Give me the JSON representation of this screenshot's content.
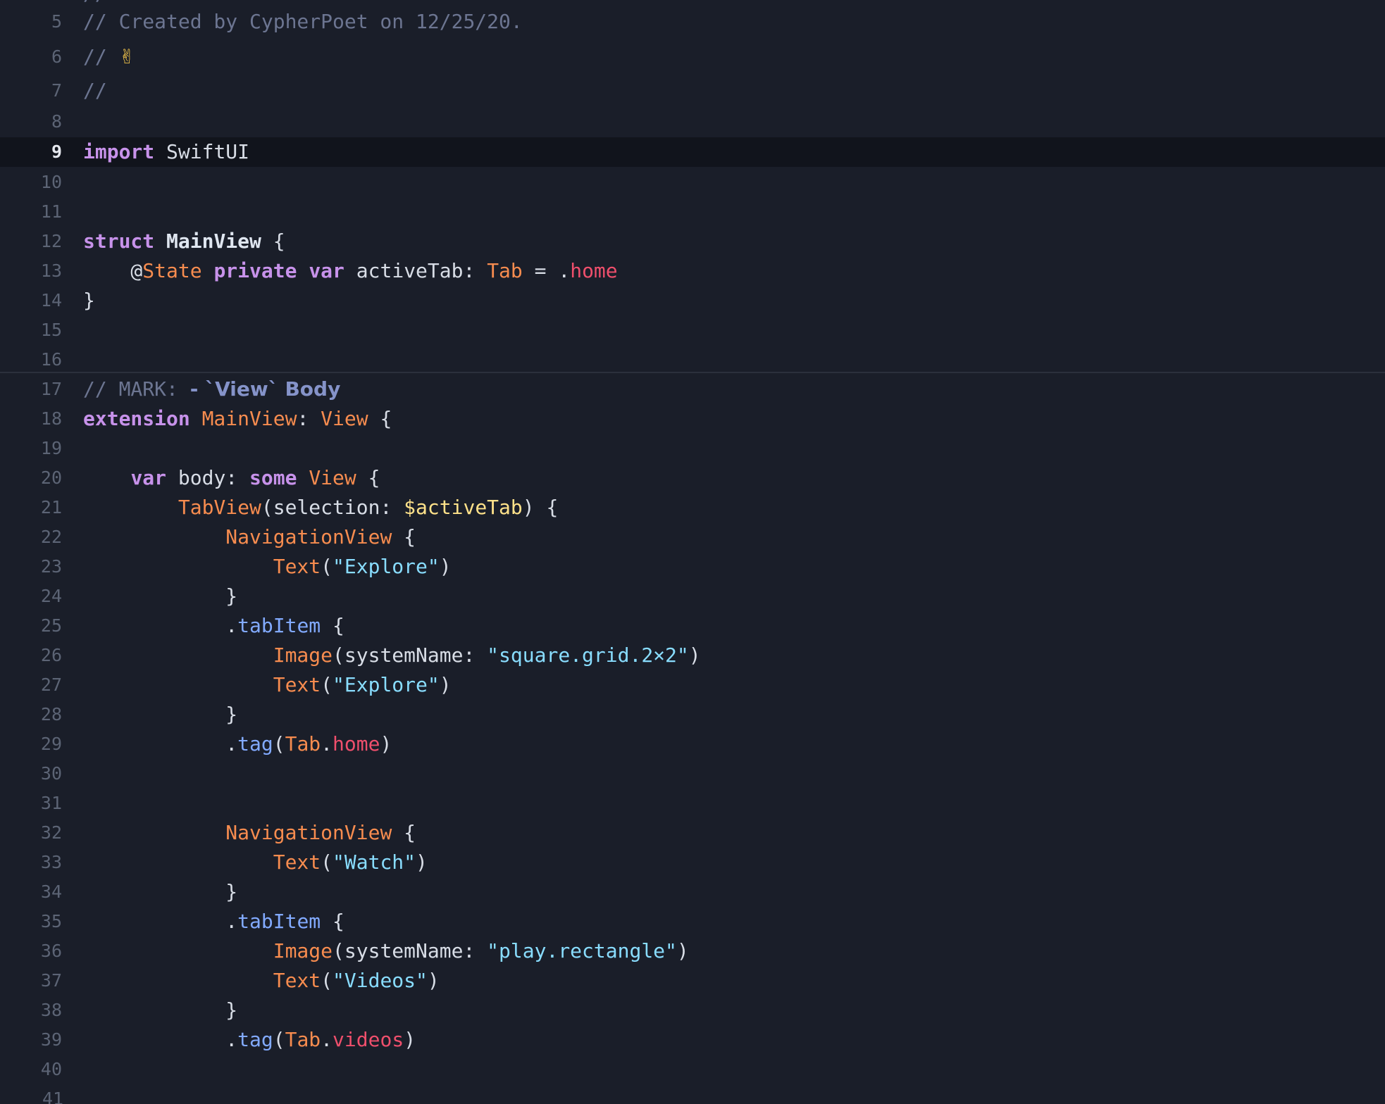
{
  "editor": {
    "current_line": "9",
    "hidden_top_comment": "//",
    "lines": [
      {
        "num": "5",
        "tokens": [
          {
            "t": "// Created by CypherPoet on 12/25/20.",
            "c": "comment"
          }
        ]
      },
      {
        "num": "6",
        "tokens": [
          {
            "t": "// ",
            "c": "comment"
          },
          {
            "t": "✌",
            "c": "emoji"
          }
        ]
      },
      {
        "num": "7",
        "tokens": [
          {
            "t": "//",
            "c": "comment"
          }
        ]
      },
      {
        "num": "8",
        "tokens": []
      },
      {
        "num": "9",
        "tokens": [
          {
            "t": "import",
            "c": "keyword"
          },
          {
            "t": " SwiftUI",
            "c": "plain"
          }
        ]
      },
      {
        "num": "10",
        "tokens": []
      },
      {
        "num": "11",
        "tokens": []
      },
      {
        "num": "12",
        "tokens": [
          {
            "t": "struct",
            "c": "keyword"
          },
          {
            "t": " ",
            "c": "plain"
          },
          {
            "t": "MainView",
            "c": "type-decl"
          },
          {
            "t": " {",
            "c": "plain"
          }
        ]
      },
      {
        "num": "13",
        "tokens": [
          {
            "t": "    @",
            "c": "plain"
          },
          {
            "t": "State",
            "c": "type"
          },
          {
            "t": " ",
            "c": "plain"
          },
          {
            "t": "private",
            "c": "keyword"
          },
          {
            "t": " ",
            "c": "plain"
          },
          {
            "t": "var",
            "c": "keyword"
          },
          {
            "t": " activeTab: ",
            "c": "plain"
          },
          {
            "t": "Tab",
            "c": "type"
          },
          {
            "t": " = .",
            "c": "plain"
          },
          {
            "t": "home",
            "c": "enum"
          }
        ]
      },
      {
        "num": "14",
        "tokens": [
          {
            "t": "}",
            "c": "plain"
          }
        ]
      },
      {
        "num": "15",
        "tokens": []
      },
      {
        "num": "16",
        "tokens": []
      },
      {
        "num": "17",
        "tokens": [
          {
            "t": "// MARK: ",
            "c": "comment"
          },
          {
            "t": "- `View` Body",
            "c": "mark-head"
          }
        ]
      },
      {
        "num": "18",
        "tokens": [
          {
            "t": "extension",
            "c": "keyword"
          },
          {
            "t": " ",
            "c": "plain"
          },
          {
            "t": "MainView",
            "c": "type"
          },
          {
            "t": ": ",
            "c": "plain"
          },
          {
            "t": "View",
            "c": "type"
          },
          {
            "t": " {",
            "c": "plain"
          }
        ]
      },
      {
        "num": "19",
        "tokens": []
      },
      {
        "num": "20",
        "tokens": [
          {
            "t": "    ",
            "c": "plain"
          },
          {
            "t": "var",
            "c": "keyword"
          },
          {
            "t": " body: ",
            "c": "plain"
          },
          {
            "t": "some",
            "c": "keyword"
          },
          {
            "t": " ",
            "c": "plain"
          },
          {
            "t": "View",
            "c": "type"
          },
          {
            "t": " {",
            "c": "plain"
          }
        ]
      },
      {
        "num": "21",
        "tokens": [
          {
            "t": "        ",
            "c": "plain"
          },
          {
            "t": "TabView",
            "c": "type"
          },
          {
            "t": "(selection: ",
            "c": "plain"
          },
          {
            "t": "$activeTab",
            "c": "binding"
          },
          {
            "t": ") {",
            "c": "plain"
          }
        ]
      },
      {
        "num": "22",
        "tokens": [
          {
            "t": "            ",
            "c": "plain"
          },
          {
            "t": "NavigationView",
            "c": "type"
          },
          {
            "t": " {",
            "c": "plain"
          }
        ]
      },
      {
        "num": "23",
        "tokens": [
          {
            "t": "                ",
            "c": "plain"
          },
          {
            "t": "Text",
            "c": "type"
          },
          {
            "t": "(",
            "c": "plain"
          },
          {
            "t": "\"Explore\"",
            "c": "string"
          },
          {
            "t": ")",
            "c": "plain"
          }
        ]
      },
      {
        "num": "24",
        "tokens": [
          {
            "t": "            }",
            "c": "plain"
          }
        ]
      },
      {
        "num": "25",
        "tokens": [
          {
            "t": "            .",
            "c": "plain"
          },
          {
            "t": "tabItem",
            "c": "method"
          },
          {
            "t": " {",
            "c": "plain"
          }
        ]
      },
      {
        "num": "26",
        "tokens": [
          {
            "t": "                ",
            "c": "plain"
          },
          {
            "t": "Image",
            "c": "type"
          },
          {
            "t": "(systemName: ",
            "c": "plain"
          },
          {
            "t": "\"square.grid.2×2\"",
            "c": "string"
          },
          {
            "t": ")",
            "c": "plain"
          }
        ]
      },
      {
        "num": "27",
        "tokens": [
          {
            "t": "                ",
            "c": "plain"
          },
          {
            "t": "Text",
            "c": "type"
          },
          {
            "t": "(",
            "c": "plain"
          },
          {
            "t": "\"Explore\"",
            "c": "string"
          },
          {
            "t": ")",
            "c": "plain"
          }
        ]
      },
      {
        "num": "28",
        "tokens": [
          {
            "t": "            }",
            "c": "plain"
          }
        ]
      },
      {
        "num": "29",
        "tokens": [
          {
            "t": "            .",
            "c": "plain"
          },
          {
            "t": "tag",
            "c": "method"
          },
          {
            "t": "(",
            "c": "plain"
          },
          {
            "t": "Tab",
            "c": "type"
          },
          {
            "t": ".",
            "c": "plain"
          },
          {
            "t": "home",
            "c": "enum"
          },
          {
            "t": ")",
            "c": "plain"
          }
        ]
      },
      {
        "num": "30",
        "tokens": []
      },
      {
        "num": "31",
        "tokens": []
      },
      {
        "num": "32",
        "tokens": [
          {
            "t": "            ",
            "c": "plain"
          },
          {
            "t": "NavigationView",
            "c": "type"
          },
          {
            "t": " {",
            "c": "plain"
          }
        ]
      },
      {
        "num": "33",
        "tokens": [
          {
            "t": "                ",
            "c": "plain"
          },
          {
            "t": "Text",
            "c": "type"
          },
          {
            "t": "(",
            "c": "plain"
          },
          {
            "t": "\"Watch\"",
            "c": "string"
          },
          {
            "t": ")",
            "c": "plain"
          }
        ]
      },
      {
        "num": "34",
        "tokens": [
          {
            "t": "            }",
            "c": "plain"
          }
        ]
      },
      {
        "num": "35",
        "tokens": [
          {
            "t": "            .",
            "c": "plain"
          },
          {
            "t": "tabItem",
            "c": "method"
          },
          {
            "t": " {",
            "c": "plain"
          }
        ]
      },
      {
        "num": "36",
        "tokens": [
          {
            "t": "                ",
            "c": "plain"
          },
          {
            "t": "Image",
            "c": "type"
          },
          {
            "t": "(systemName: ",
            "c": "plain"
          },
          {
            "t": "\"play.rectangle\"",
            "c": "string"
          },
          {
            "t": ")",
            "c": "plain"
          }
        ]
      },
      {
        "num": "37",
        "tokens": [
          {
            "t": "                ",
            "c": "plain"
          },
          {
            "t": "Text",
            "c": "type"
          },
          {
            "t": "(",
            "c": "plain"
          },
          {
            "t": "\"Videos\"",
            "c": "string"
          },
          {
            "t": ")",
            "c": "plain"
          }
        ]
      },
      {
        "num": "38",
        "tokens": [
          {
            "t": "            }",
            "c": "plain"
          }
        ]
      },
      {
        "num": "39",
        "tokens": [
          {
            "t": "            .",
            "c": "plain"
          },
          {
            "t": "tag",
            "c": "method"
          },
          {
            "t": "(",
            "c": "plain"
          },
          {
            "t": "Tab",
            "c": "type"
          },
          {
            "t": ".",
            "c": "plain"
          },
          {
            "t": "videos",
            "c": "enum"
          },
          {
            "t": ")",
            "c": "plain"
          }
        ]
      },
      {
        "num": "40",
        "tokens": []
      }
    ],
    "partial_bottom_line": "41"
  },
  "colors": {
    "background": "#1a1e29",
    "current_line_bg": "#11141c",
    "comment": "#6c7591",
    "keyword": "#c792ea",
    "type": "#f78c4f",
    "enum_case": "#ef4f6c",
    "string": "#89ddff",
    "method": "#82aaff",
    "binding": "#ffe28a"
  }
}
